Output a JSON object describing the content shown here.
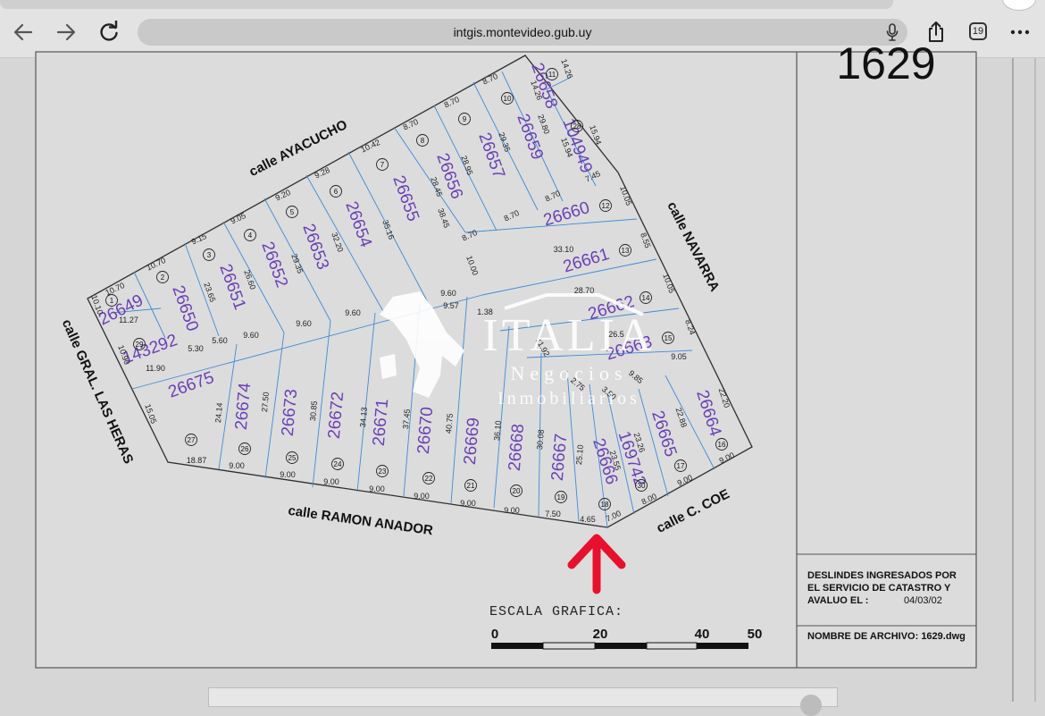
{
  "browser": {
    "url": "intgis.montevideo.gub.uy",
    "tab_count": "19",
    "icons": [
      "back-arrow-icon",
      "forward-arrow-icon",
      "reload-icon",
      "microphone-icon",
      "share-icon",
      "tabs-icon",
      "more-icon"
    ]
  },
  "plan": {
    "plan_number": "1629",
    "streets": {
      "ayacucho": "calle AYACUCHO",
      "navarra": "calle NAVARRA",
      "las_heras": "calle GRAL. LAS HERAS",
      "ramon_anador": "calle RAMON ANADOR",
      "coe": "calle C. COE"
    },
    "note_lines": [
      "DESLINDES INGRESADOS POR",
      "EL SERVICIO DE CATASTRO Y",
      "AVALUO EL :"
    ],
    "note_date": "04/03/02",
    "file_name": "NOMBRE DE ARCHIVO: 1629.dwg",
    "scale_label": "ESCALA GRAFICA:",
    "scale_ticks": [
      "0",
      "20",
      "40",
      "50"
    ],
    "watermark": {
      "brand": "ITALIA",
      "line2": "Negocios",
      "line3": "Inmobiliarios"
    },
    "padrones": [
      {
        "num": "26649",
        "lot": "1"
      },
      {
        "num": "26650",
        "lot": "2"
      },
      {
        "num": "26651",
        "lot": "3"
      },
      {
        "num": "26652",
        "lot": "4"
      },
      {
        "num": "26653",
        "lot": "5"
      },
      {
        "num": "26654",
        "lot": "6"
      },
      {
        "num": "26655",
        "lot": "7"
      },
      {
        "num": "26656",
        "lot": "8"
      },
      {
        "num": "26657",
        "lot": "9"
      },
      {
        "num": "26659",
        "lot": "10"
      },
      {
        "num": "26658",
        "lot": "11"
      },
      {
        "num": "26660",
        "lot": "12"
      },
      {
        "num": "26661",
        "lot": "13"
      },
      {
        "num": "26662",
        "lot": "14"
      },
      {
        "num": "26663",
        "lot": "15"
      },
      {
        "num": "26664",
        "lot": "16"
      },
      {
        "num": "26665",
        "lot": "17"
      },
      {
        "num": "26666",
        "lot": "18"
      },
      {
        "num": "26667",
        "lot": "19"
      },
      {
        "num": "26668",
        "lot": "20"
      },
      {
        "num": "26669",
        "lot": "21"
      },
      {
        "num": "26670",
        "lot": "22"
      },
      {
        "num": "26671",
        "lot": "23"
      },
      {
        "num": "26672",
        "lot": "24"
      },
      {
        "num": "26673",
        "lot": "25"
      },
      {
        "num": "26674",
        "lot": "26"
      },
      {
        "num": "26675",
        "lot": "27"
      },
      {
        "num": "104949",
        "lot": "28"
      },
      {
        "num": "143292",
        "lot": "29"
      },
      {
        "num": "169742",
        "lot": "30"
      }
    ],
    "dimensions": [
      "10.70",
      "10.70",
      "9.15",
      "9.05",
      "9.20",
      "9.28",
      "10.42",
      "8.70",
      "8.70",
      "8.70",
      "14.26",
      "14.26",
      "29.80",
      "15.94",
      "15.94",
      "7.45",
      "8.70",
      "8.70",
      "8.70",
      "29.35",
      "28.95",
      "28.45",
      "38.45",
      "35.16",
      "32.20",
      "29.35",
      "26.60",
      "23.65",
      "11.27",
      "10.10",
      "10.90",
      "11.90",
      "5.30",
      "5.60",
      "9.60",
      "9.60",
      "9.60",
      "9.60",
      "9.57",
      "1.38",
      "10.00",
      "10.05",
      "8.55",
      "33.10",
      "28.70",
      "10.05",
      "8.24",
      "9.05",
      "26.5",
      "11.92",
      "2.75",
      "3.50",
      "9.85",
      "22.20",
      "22.88",
      "23.26",
      "23.55",
      "25.10",
      "30.08",
      "36.10",
      "40.75",
      "37.45",
      "34.13",
      "30.85",
      "27.50",
      "24.14",
      "15.05",
      "18.87",
      "9.00",
      "9.00",
      "9.00",
      "9.00",
      "9.00",
      "9.00",
      "9.00",
      "7.50",
      "4.65",
      "7.00",
      "8.00",
      "9.00",
      "9.00"
    ]
  }
}
